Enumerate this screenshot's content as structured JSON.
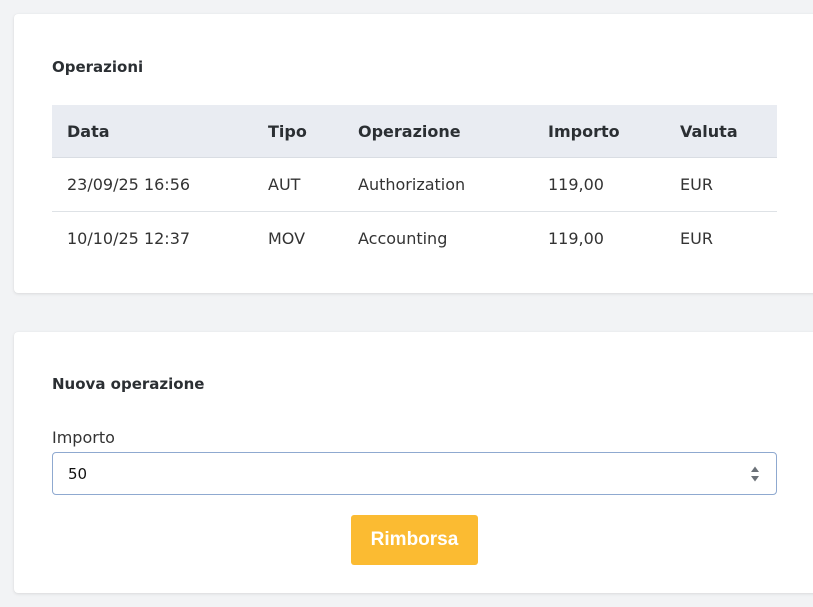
{
  "operations": {
    "title": "Operazioni",
    "columns": [
      "Data",
      "Tipo",
      "Operazione",
      "Importo",
      "Valuta"
    ],
    "rows": [
      [
        "23/09/25 16:56",
        "AUT",
        "Authorization",
        "119,00",
        "EUR"
      ],
      [
        "10/10/25 12:37",
        "MOV",
        "Accounting",
        "119,00",
        "EUR"
      ]
    ]
  },
  "new_operation": {
    "title": "Nuova operazione",
    "amount_label": "Importo",
    "amount_value": "50",
    "submit_label": "Rimborsa"
  },
  "colors": {
    "accent": "#fbbb32",
    "header_bg": "#e9ecf2",
    "input_border": "#8fa9d0"
  },
  "icons": {
    "stepper_up": "chevron-up-icon",
    "stepper_down": "chevron-down-icon"
  }
}
